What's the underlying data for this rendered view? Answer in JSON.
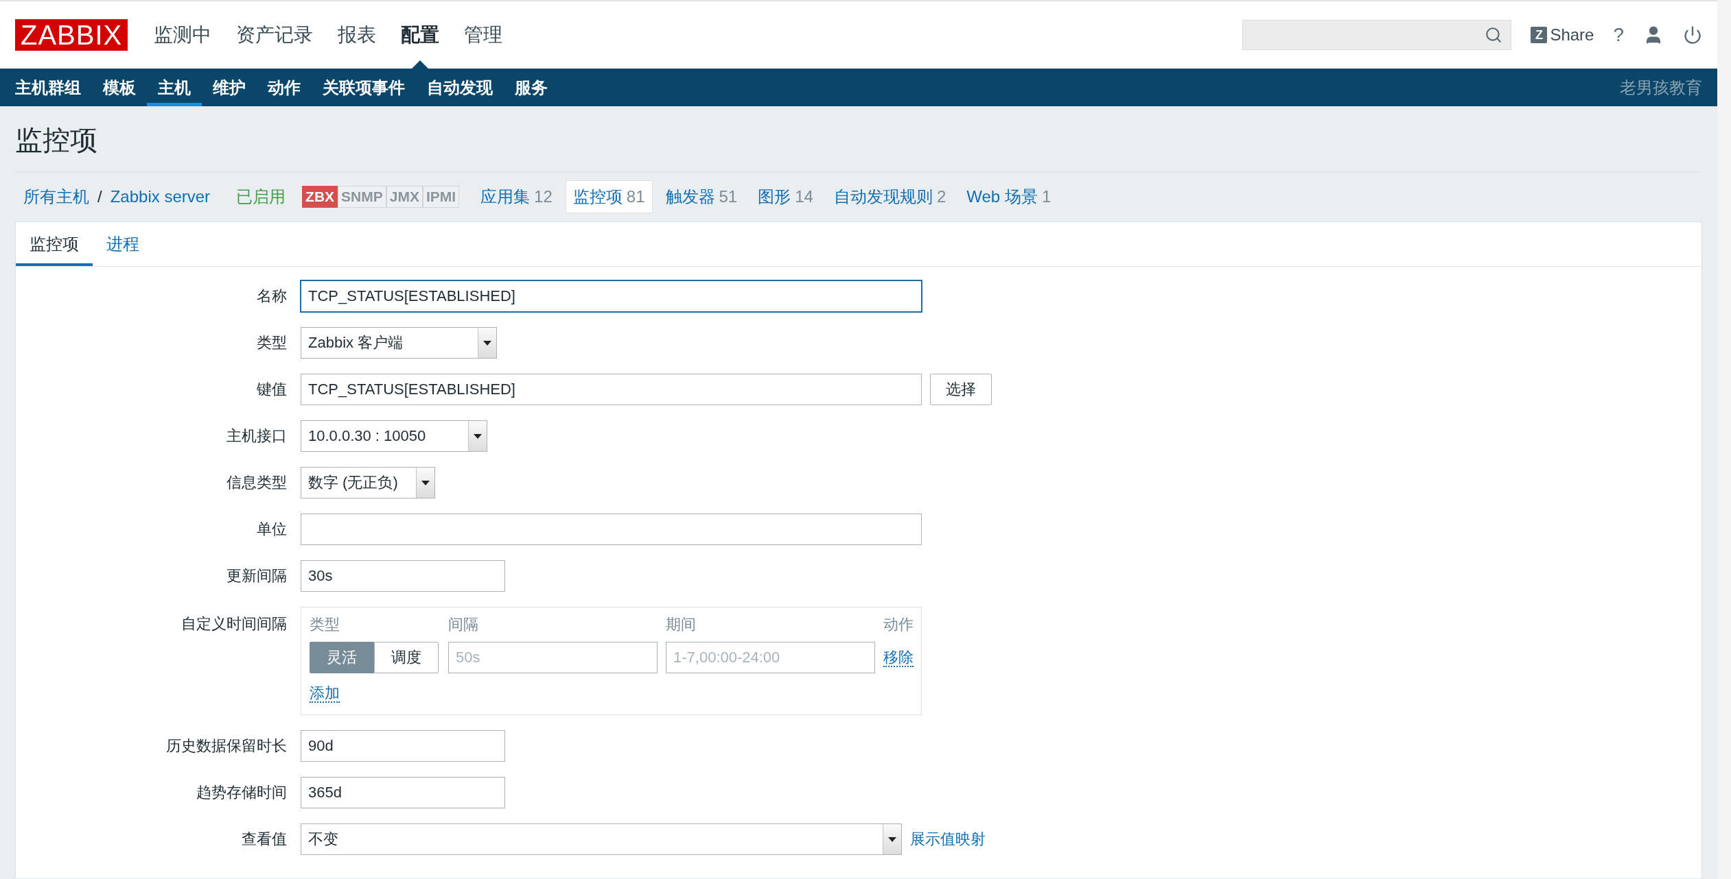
{
  "header": {
    "logo": "ZABBIX",
    "menu": [
      {
        "label": "监测中",
        "selected": false
      },
      {
        "label": "资产记录",
        "selected": false
      },
      {
        "label": "报表",
        "selected": false
      },
      {
        "label": "配置",
        "selected": true
      },
      {
        "label": "管理",
        "selected": false
      }
    ],
    "share": {
      "letter": "Z",
      "label": "Share"
    },
    "help": "?"
  },
  "subnav": {
    "items": [
      {
        "label": "主机群组",
        "selected": false
      },
      {
        "label": "模板",
        "selected": false
      },
      {
        "label": "主机",
        "selected": true
      },
      {
        "label": "维护",
        "selected": false
      },
      {
        "label": "动作",
        "selected": false
      },
      {
        "label": "关联项事件",
        "selected": false
      },
      {
        "label": "自动发现",
        "selected": false
      },
      {
        "label": "服务",
        "selected": false
      }
    ],
    "brand": "老男孩教育"
  },
  "page_title": "监控项",
  "breadcrumb": {
    "path": [
      "所有主机",
      "Zabbix server"
    ],
    "separator": "/",
    "status": "已启用",
    "availability": [
      {
        "label": "ZBX",
        "on": true
      },
      {
        "label": "SNMP",
        "on": false
      },
      {
        "label": "JMX",
        "on": false
      },
      {
        "label": "IPMI",
        "on": false
      }
    ],
    "links": [
      {
        "label": "应用集",
        "count": "12",
        "selected": false
      },
      {
        "label": "监控项",
        "count": "81",
        "selected": true
      },
      {
        "label": "触发器",
        "count": "51",
        "selected": false
      },
      {
        "label": "图形",
        "count": "14",
        "selected": false
      },
      {
        "label": "自动发现规则",
        "count": "2",
        "selected": false
      },
      {
        "label": "Web 场景",
        "count": "1",
        "selected": false
      }
    ]
  },
  "tabs": [
    {
      "label": "监控项",
      "selected": true
    },
    {
      "label": "进程",
      "selected": false
    }
  ],
  "form": {
    "fields": [
      {
        "label": "名称",
        "kind": "input",
        "value": "TCP_STATUS[ESTABLISHED]",
        "focused": true
      },
      {
        "label": "类型",
        "kind": "select",
        "value": "Zabbix 客户端"
      },
      {
        "label": "键值",
        "kind": "input",
        "value": "TCP_STATUS[ESTABLISHED]",
        "focused": false,
        "button": "选择"
      },
      {
        "label": "主机接口",
        "kind": "select",
        "value": "10.0.0.30 : 10050"
      },
      {
        "label": "信息类型",
        "kind": "select",
        "value": "数字 (无正负)"
      },
      {
        "label": "单位",
        "kind": "input",
        "focused": false
      },
      {
        "label": "更新间隔",
        "kind": "input",
        "value": "30s",
        "focused": false
      },
      {
        "label": "自定义时间间隔",
        "kind": "intervals",
        "columns": [
          "类型",
          "间隔",
          "期间",
          "动作"
        ],
        "rows": [
          {
            "modes": [
              {
                "label": "灵活",
                "selected": true
              },
              {
                "label": "调度",
                "selected": false
              }
            ],
            "interval_placeholder": "50s",
            "period_placeholder": "1-7,00:00-24:00",
            "remove": "移除"
          }
        ],
        "add": "添加"
      },
      {
        "label": "历史数据保留时长",
        "kind": "input",
        "value": "90d",
        "focused": false
      },
      {
        "label": "趋势存储时间",
        "kind": "input",
        "value": "365d",
        "focused": false
      },
      {
        "label": "查看值",
        "kind": "select",
        "value": "不变",
        "link": "展示值映射"
      }
    ]
  }
}
